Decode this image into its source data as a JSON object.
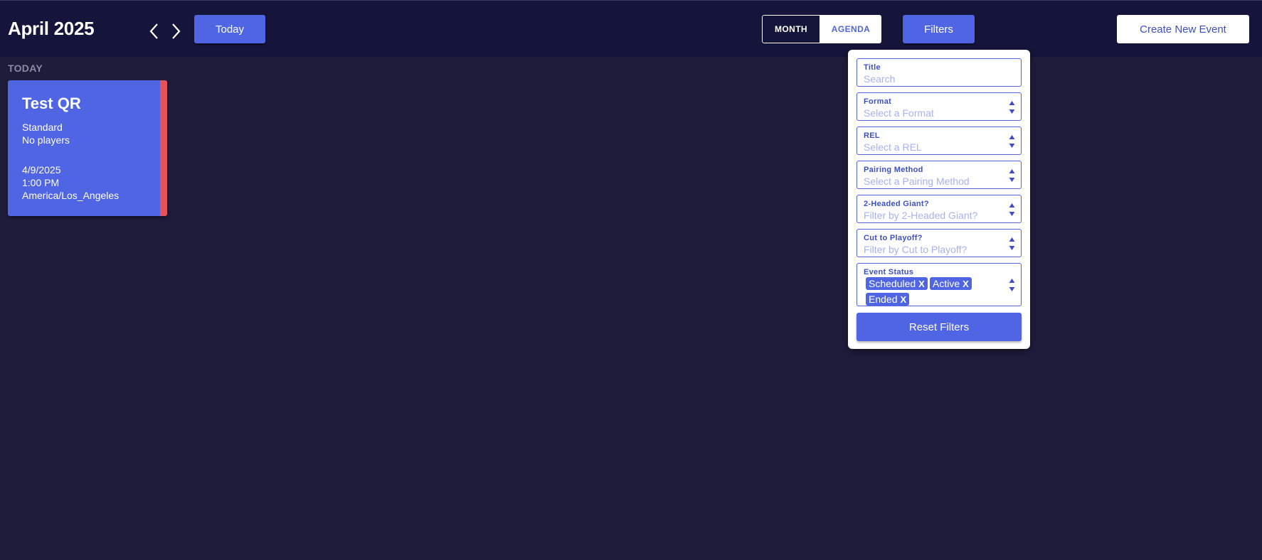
{
  "header": {
    "month_title": "April 2025",
    "today_label": "Today",
    "view_month": "MONTH",
    "view_agenda": "AGENDA",
    "filters_label": "Filters",
    "create_label": "Create New Event"
  },
  "day_section": {
    "label": "TODAY"
  },
  "event": {
    "title": "Test QR",
    "format": "Standard",
    "players": "No players",
    "date": "4/9/2025",
    "time": "1:00 PM",
    "timezone": "America/Los_Angeles",
    "accent_color": "#e5525a"
  },
  "filters": {
    "title": {
      "label": "Title",
      "placeholder": "Search"
    },
    "format": {
      "label": "Format",
      "placeholder": "Select a Format"
    },
    "rel": {
      "label": "REL",
      "placeholder": "Select a REL"
    },
    "pairing": {
      "label": "Pairing Method",
      "placeholder": "Select a Pairing Method"
    },
    "two_headed": {
      "label": "2-Headed Giant?",
      "placeholder": "Filter by 2-Headed Giant?"
    },
    "cut": {
      "label": "Cut to Playoff?",
      "placeholder": "Filter by Cut to Playoff?"
    },
    "status": {
      "label": "Event Status",
      "chips": [
        "Scheduled",
        "Active",
        "Ended"
      ],
      "remove_glyph": "X"
    },
    "reset_label": "Reset Filters"
  },
  "colors": {
    "background": "#1e1c3b",
    "header": "#15143a",
    "accent": "#5065e3"
  }
}
